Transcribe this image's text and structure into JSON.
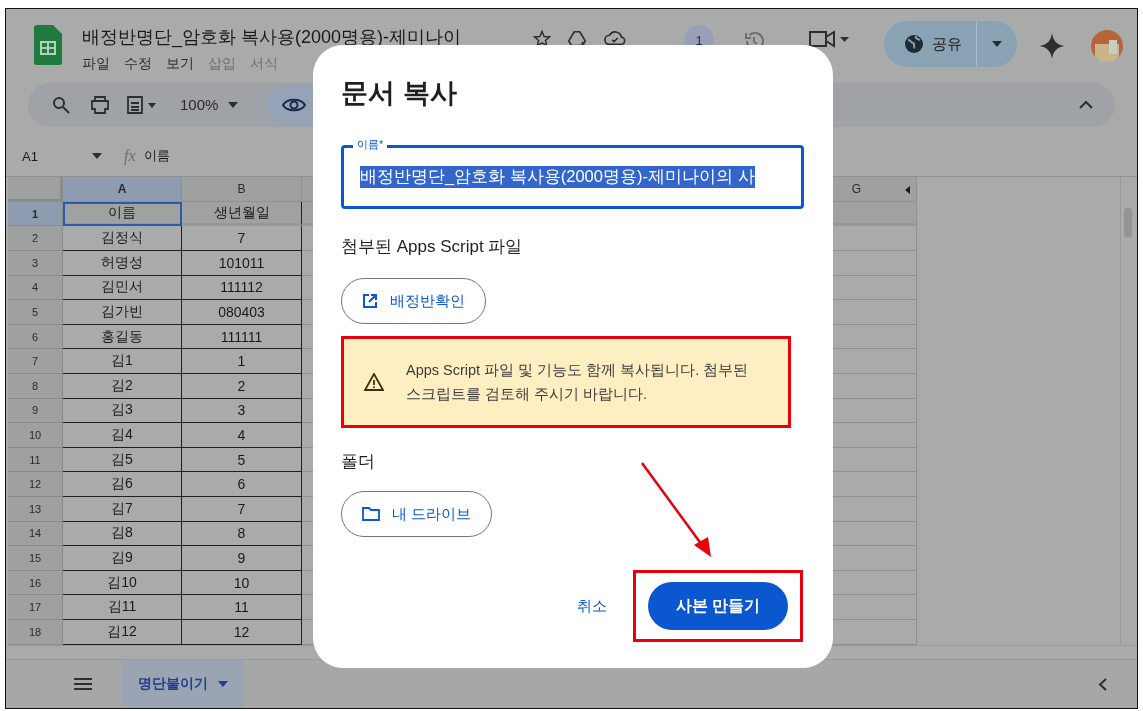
{
  "app": {
    "title": "배정반명단_암호화 복사용(2000명용)-제미나이",
    "menu": [
      {
        "label": "파일",
        "disabled": false
      },
      {
        "label": "수정",
        "disabled": false
      },
      {
        "label": "보기",
        "disabled": false
      },
      {
        "label": "삽입",
        "disabled": true
      },
      {
        "label": "서식",
        "disabled": true
      }
    ],
    "collaborator_count": "1",
    "share_label": "공유"
  },
  "toolbar": {
    "zoom": "100%"
  },
  "formula_bar": {
    "cell_ref": "A1",
    "fx": "fx",
    "content": "이름"
  },
  "sheet": {
    "columns": [
      {
        "label": "A",
        "selected": true
      },
      {
        "label": "B",
        "selected": false
      },
      {
        "label": "G",
        "selected": false
      }
    ],
    "rows": [
      {
        "number": "1",
        "selected": true,
        "cells": [
          {
            "text": "이름",
            "selected": true
          },
          {
            "text": "생년월일",
            "selected": false
          }
        ]
      },
      {
        "number": "2",
        "selected": false,
        "cells": [
          {
            "text": "김정식",
            "selected": false
          },
          {
            "text": "7",
            "selected": false
          }
        ]
      },
      {
        "number": "3",
        "selected": false,
        "cells": [
          {
            "text": "허명성",
            "selected": false
          },
          {
            "text": "101011",
            "selected": false
          }
        ]
      },
      {
        "number": "4",
        "selected": false,
        "cells": [
          {
            "text": "김민서",
            "selected": false
          },
          {
            "text": "111112",
            "selected": false
          }
        ]
      },
      {
        "number": "5",
        "selected": false,
        "cells": [
          {
            "text": "김가빈",
            "selected": false
          },
          {
            "text": "080403",
            "selected": false
          }
        ]
      },
      {
        "number": "6",
        "selected": false,
        "cells": [
          {
            "text": "홍길동",
            "selected": false
          },
          {
            "text": "111111",
            "selected": false
          }
        ]
      },
      {
        "number": "7",
        "selected": false,
        "cells": [
          {
            "text": "김1",
            "selected": false
          },
          {
            "text": "1",
            "selected": false
          }
        ]
      },
      {
        "number": "8",
        "selected": false,
        "cells": [
          {
            "text": "김2",
            "selected": false
          },
          {
            "text": "2",
            "selected": false
          }
        ]
      },
      {
        "number": "9",
        "selected": false,
        "cells": [
          {
            "text": "김3",
            "selected": false
          },
          {
            "text": "3",
            "selected": false
          }
        ]
      },
      {
        "number": "10",
        "selected": false,
        "cells": [
          {
            "text": "김4",
            "selected": false
          },
          {
            "text": "4",
            "selected": false
          }
        ]
      },
      {
        "number": "11",
        "selected": false,
        "cells": [
          {
            "text": "김5",
            "selected": false
          },
          {
            "text": "5",
            "selected": false
          }
        ]
      },
      {
        "number": "12",
        "selected": false,
        "cells": [
          {
            "text": "김6",
            "selected": false
          },
          {
            "text": "6",
            "selected": false
          }
        ]
      },
      {
        "number": "13",
        "selected": false,
        "cells": [
          {
            "text": "김7",
            "selected": false
          },
          {
            "text": "7",
            "selected": false
          }
        ]
      },
      {
        "number": "14",
        "selected": false,
        "cells": [
          {
            "text": "김8",
            "selected": false
          },
          {
            "text": "8",
            "selected": false
          }
        ]
      },
      {
        "number": "15",
        "selected": false,
        "cells": [
          {
            "text": "김9",
            "selected": false
          },
          {
            "text": "9",
            "selected": false
          }
        ]
      },
      {
        "number": "16",
        "selected": false,
        "cells": [
          {
            "text": "김10",
            "selected": false
          },
          {
            "text": "10",
            "selected": false
          }
        ]
      },
      {
        "number": "17",
        "selected": false,
        "cells": [
          {
            "text": "김11",
            "selected": false
          },
          {
            "text": "11",
            "selected": false
          }
        ]
      },
      {
        "number": "18",
        "selected": false,
        "cells": [
          {
            "text": "김12",
            "selected": false
          },
          {
            "text": "12",
            "selected": false
          }
        ]
      }
    ]
  },
  "sheet_tabs": [
    {
      "label": "명단붙이기",
      "selected": true
    }
  ],
  "dialog": {
    "title": "문서 복사",
    "name_field": {
      "label": "이름*",
      "value": "배정반명단_암호화 복사용(2000명용)-제미나이의 사",
      "text_selected": true
    },
    "script_heading": "첨부된 Apps Script 파일",
    "script_button": "배정반확인",
    "warning": "Apps Script 파일 및 기능도 함께 복사됩니다. 첨부된 스크립트를 검토해 주시기 바랍니다.",
    "folder_heading": "폴더",
    "folder_button": "내 드라이브",
    "cancel": "취소",
    "confirm": "사본 만들기"
  }
}
